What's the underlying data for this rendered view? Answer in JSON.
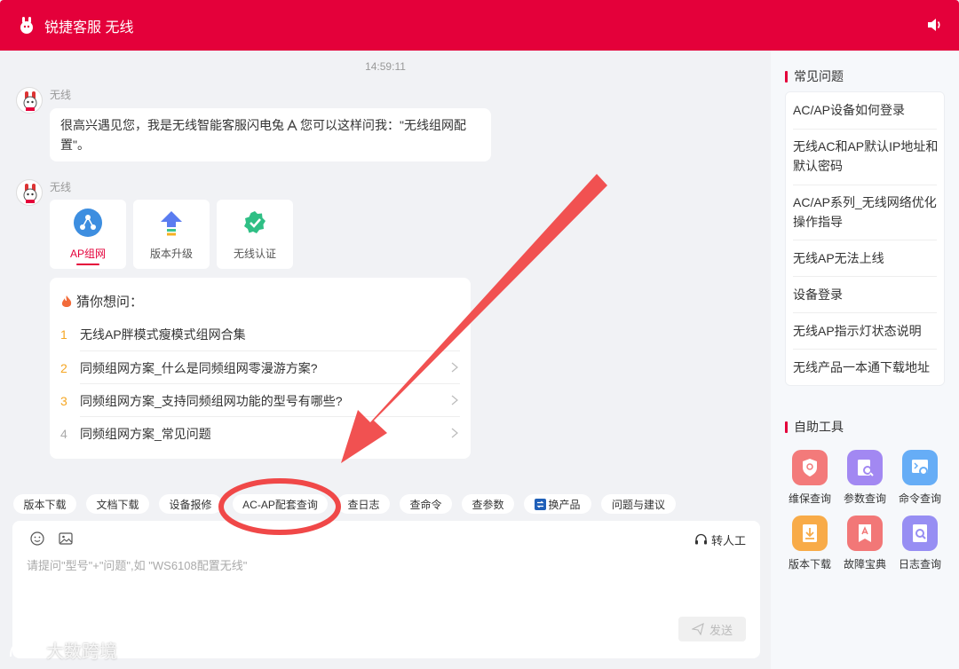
{
  "header": {
    "title": "锐捷客服 无线"
  },
  "chat": {
    "timestamp": "14:59:11",
    "messages": [
      {
        "sender": "无线",
        "text_a": "很高兴遇见您，我是无线智能客服闪电兔",
        "text_b": "您可以这样问我：\"无线组网配",
        "text_c": "置\"。"
      },
      {
        "sender": "无线"
      }
    ],
    "cards": [
      {
        "label": "AP组网",
        "icon": "network-icon"
      },
      {
        "label": "版本升级",
        "icon": "upgrade-icon"
      },
      {
        "label": "无线认证",
        "icon": "shield-check-icon"
      }
    ],
    "guess": {
      "title": "猜你想问：",
      "items": [
        {
          "num": "1",
          "text": "无线AP胖模式瘦模式组网合集"
        },
        {
          "num": "2",
          "text": "同频组网方案_什么是同频组网零漫游方案?"
        },
        {
          "num": "3",
          "text": "同频组网方案_支持同频组网功能的型号有哪些?"
        },
        {
          "num": "4",
          "text": "同频组网方案_常见问题"
        }
      ]
    }
  },
  "quick_actions": [
    "版本下载",
    "文档下载",
    "设备报修",
    "AC-AP配套查询",
    "查日志",
    "查命令",
    "查参数",
    "换产品",
    "问题与建议"
  ],
  "input": {
    "placeholder": "请提问\"型号\"+\"问题\",如 \"WS6108配置无线\"",
    "transfer_label": "转人工",
    "send_label": "发送"
  },
  "sidebar": {
    "faq_title": "常见问题",
    "faq": [
      "AC/AP设备如何登录",
      "无线AC和AP默认IP地址和默认密码",
      "AC/AP系列_无线网络优化操作指导",
      "无线AP无法上线",
      "设备登录",
      "无线AP指示灯状态说明",
      "无线产品一本通下载地址"
    ],
    "tools_title": "自助工具",
    "tools": [
      {
        "label": "维保查询",
        "color": "#f26b6b"
      },
      {
        "label": "参数查询",
        "color": "#9b7bf0"
      },
      {
        "label": "命令查询",
        "color": "#5ba6f5"
      },
      {
        "label": "版本下载",
        "color": "#f7a43c"
      },
      {
        "label": "故障宝典",
        "color": "#f06b6b"
      },
      {
        "label": "日志查询",
        "color": "#8f86f2"
      }
    ]
  },
  "watermark": "大数跨境",
  "colors": {
    "brand": "#e4003a",
    "annotation": "#f04848"
  }
}
